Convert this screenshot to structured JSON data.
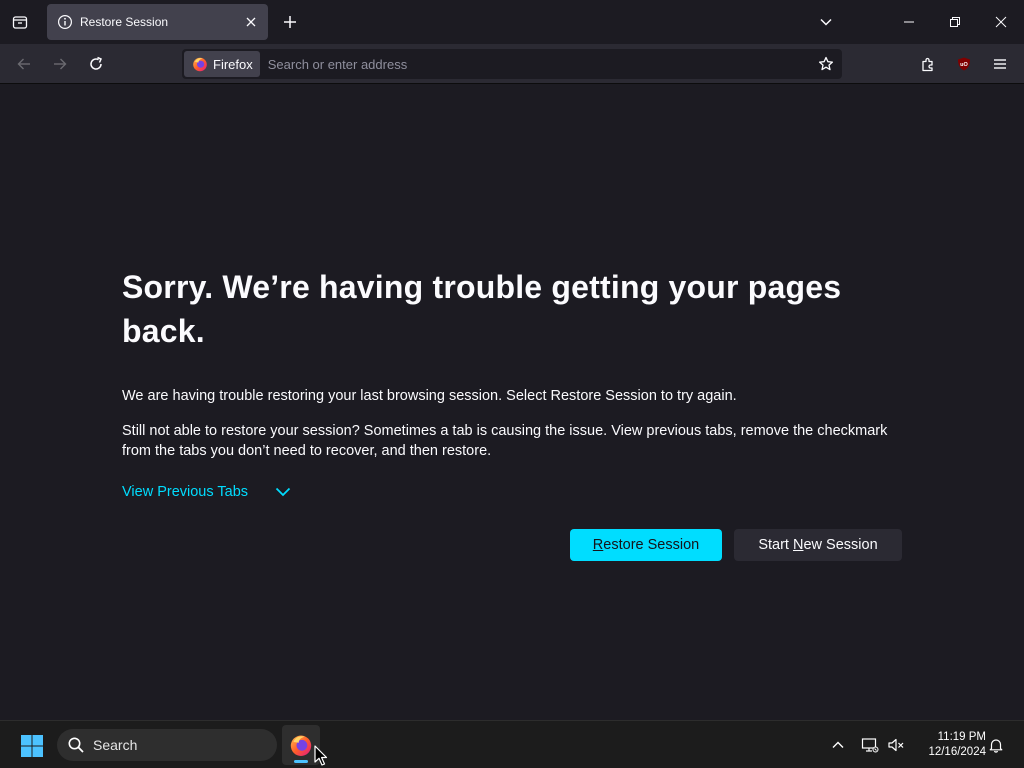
{
  "browser": {
    "tab": {
      "title": "Restore Session"
    },
    "urlbar": {
      "identity_label": "Firefox",
      "placeholder": "Search or enter address"
    }
  },
  "page": {
    "heading": "Sorry. We’re having trouble getting your pages back.",
    "paragraph_1": "We are having trouble restoring your last browsing session. Select Restore Session to try again.",
    "paragraph_2": "Still not able to restore your session? Sometimes a tab is causing the issue. View previous tabs, remove the checkmark from the tabs you don’t need to recover, and then restore.",
    "view_previous_tabs": "View Previous Tabs",
    "restore_button": {
      "accel": "R",
      "rest": "estore Session"
    },
    "new_session_button": {
      "before": "Start ",
      "accel": "N",
      "after": "ew Session"
    }
  },
  "taskbar": {
    "search_label": "Search",
    "time": "11:19 PM",
    "date": "12/16/2024"
  },
  "colors": {
    "accent": "#00ddff",
    "background": "#1c1b22",
    "toolbar": "#2b2a33",
    "selected_tab": "#42414d"
  },
  "icons": [
    "tab-list-icon",
    "info-icon",
    "close-icon",
    "plus-icon",
    "chevron-down-icon",
    "minimize-icon",
    "restore-icon",
    "back-arrow-icon",
    "forward-arrow-icon",
    "reload-icon",
    "firefox-icon",
    "star-icon",
    "puzzle-icon",
    "ublock-icon",
    "hamburger-menu-icon",
    "windows-logo-icon",
    "search-icon",
    "network-icon",
    "volume-muted-icon",
    "bell-icon"
  ]
}
